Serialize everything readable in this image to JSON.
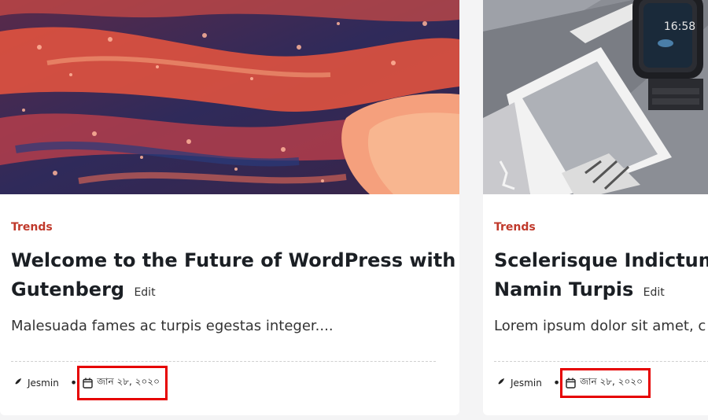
{
  "posts": [
    {
      "category": "Trends",
      "title_line1": "Welcome to the Future of WordPress with",
      "title_line2": "Gutenberg",
      "edit_label": "Edit",
      "excerpt": "Malesuada fames ac turpis egestas integer....",
      "author": "Jesmin",
      "date": "জান ২৮, ২০২০",
      "image_icon": "abstract-fluid-art-image"
    },
    {
      "category": "Trends",
      "title_line1": "Scelerisque Indictum I",
      "title_line2": "Namin Turpis",
      "edit_label": "Edit",
      "excerpt": "Lorem ipsum dolor sit amet, c",
      "author": "Jesmin",
      "date": "জান ২৮, ২০২০",
      "image_icon": "smartwatch-desk-image",
      "watch_time": "16:58"
    }
  ],
  "colors": {
    "category": "#c0392b",
    "highlight_border": "#e60000",
    "title": "#1b1f24"
  }
}
